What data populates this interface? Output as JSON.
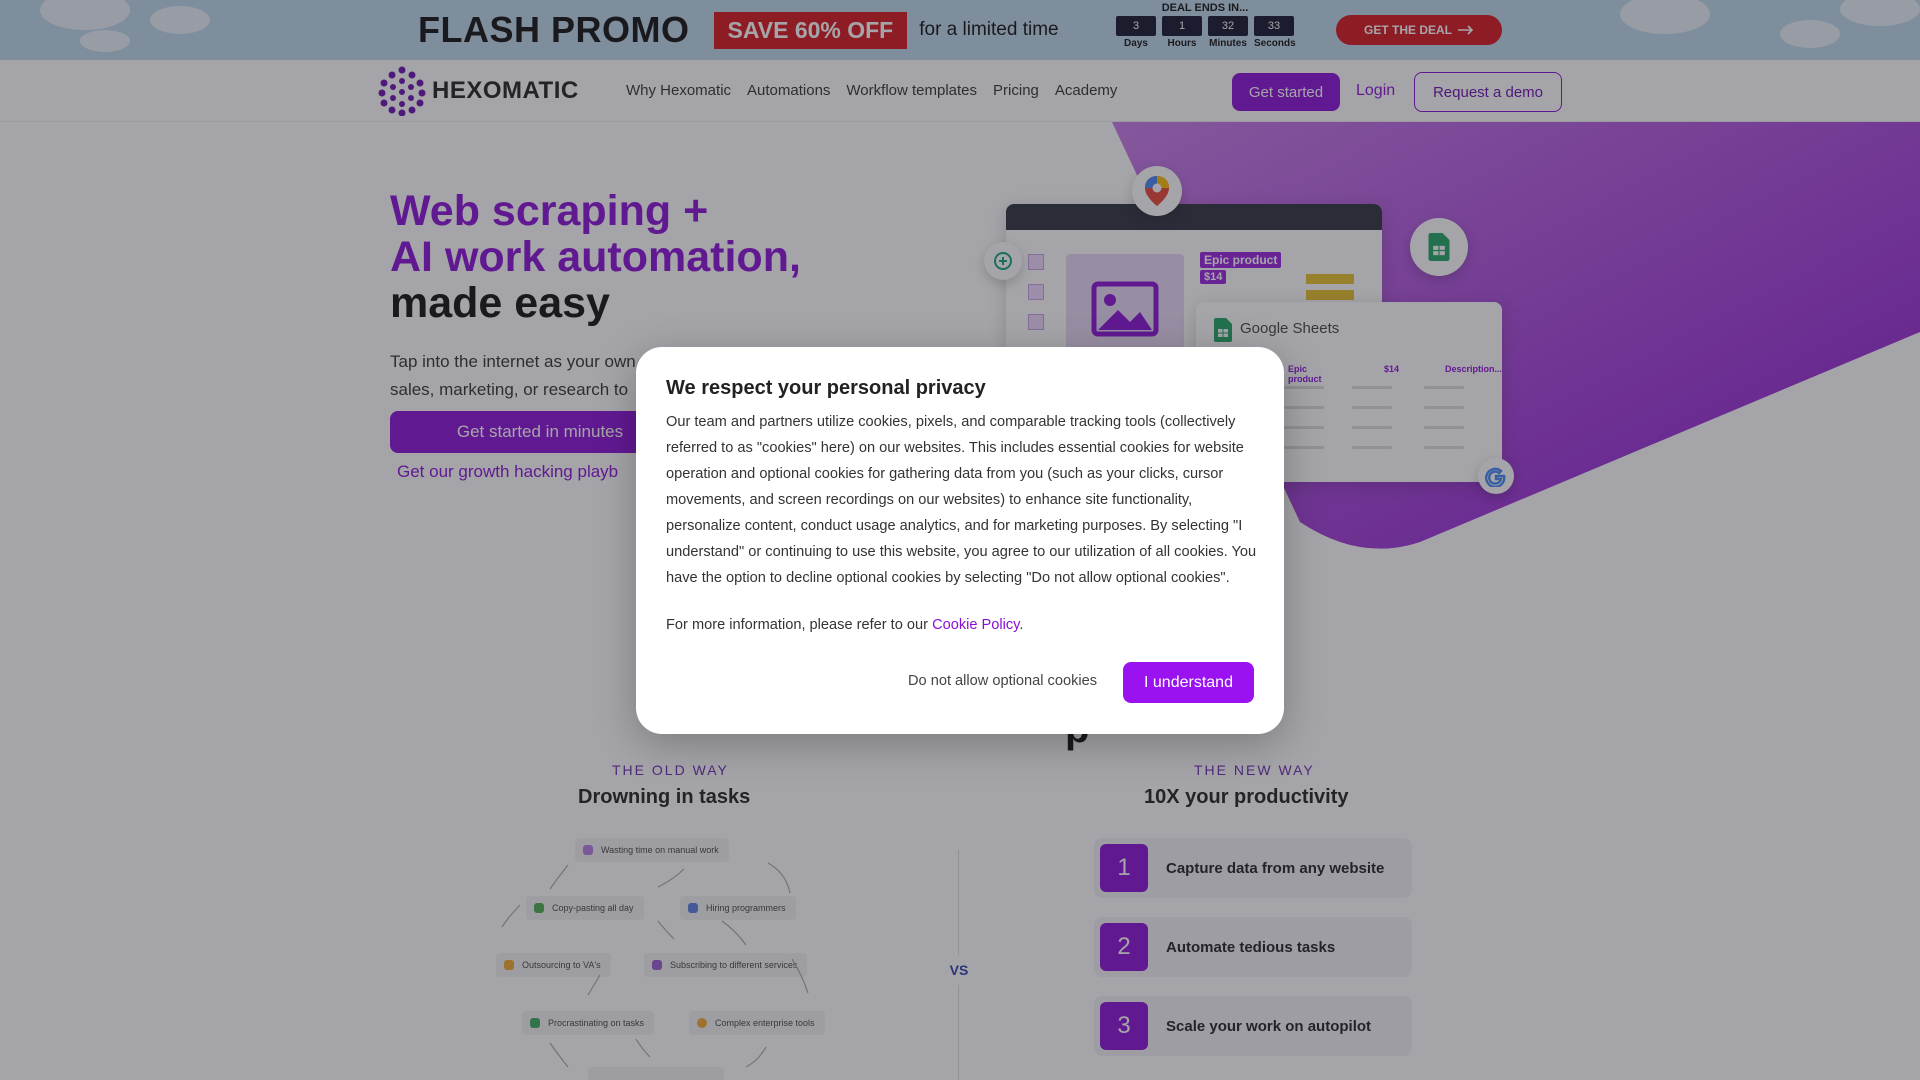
{
  "promo": {
    "title": "FLASH PROMO",
    "save": "SAVE 60% OFF",
    "limited": "for a limited time",
    "deal_title": "DEAL ENDS IN...",
    "countdown": [
      {
        "value": "3",
        "label": "Days"
      },
      {
        "value": "1",
        "label": "Hours"
      },
      {
        "value": "32",
        "label": "Minutes"
      },
      {
        "value": "33",
        "label": "Seconds"
      }
    ],
    "deal_button": "GET THE DEAL"
  },
  "nav": {
    "brand": "HEXOMATIC",
    "links": [
      "Why Hexomatic",
      "Automations",
      "Workflow templates",
      "Pricing",
      "Academy"
    ],
    "get_started": "Get started",
    "login": "Login",
    "request_demo": "Request a demo"
  },
  "hero": {
    "line1": "Web scraping +",
    "line2": "AI work automation,",
    "line3": "made easy",
    "sub": "Tap into the internet as your own sales, marketing, or research to",
    "cta": "Get started in minutes",
    "playbook_link": "Get our growth hacking playb",
    "mock": {
      "label": "Epic product",
      "price": "$14",
      "sheet_title": "Google Sheets",
      "sheet_cols": [
        "Epic product",
        "$14",
        "Description..."
      ]
    }
  },
  "compare": {
    "old_kicker": "THE OLD WAY",
    "old_title": "Drowning in tasks",
    "new_kicker": "THE NEW WAY",
    "new_title": "10X your productivity",
    "vs": "VS",
    "tasks": [
      "Wasting time on manual work",
      "Copy-pasting all day",
      "Hiring programmers",
      "Outsourcing to VA's",
      "Subscribing to different services",
      "Procrastinating on tasks",
      "Complex enterprise tools"
    ],
    "steps": [
      {
        "num": "1",
        "text": "Capture data from any website"
      },
      {
        "num": "2",
        "text": "Automate tedious tasks"
      },
      {
        "num": "3",
        "text": "Scale your work on autopilot"
      }
    ]
  },
  "modal": {
    "title": "We respect your personal privacy",
    "body": "Our team and partners utilize cookies, pixels, and comparable tracking tools (collectively referred to as \"cookies\" here) on our websites. This includes essential cookies for website operation and optional cookies for gathering data from you (such as your clicks, cursor movements, and screen recordings on our websites) to enhance site functionality, personalize content, conduct usage analytics, and for marketing purposes. By selecting \"I understand\" or continuing to use this website, you agree to our utilization of all cookies. You have the option to decline optional cookies by selecting \"Do not allow optional cookies\".",
    "more_prefix": "For more information, please refer to our",
    "policy_link": "Cookie Policy",
    "more_suffix": ".",
    "decline": "Do not allow optional cookies",
    "accept": "I understand"
  },
  "colors": {
    "brand_purple": "#8a0fd6",
    "promo_red": "#d6141c",
    "promo_sky": "#bcd7ea"
  }
}
